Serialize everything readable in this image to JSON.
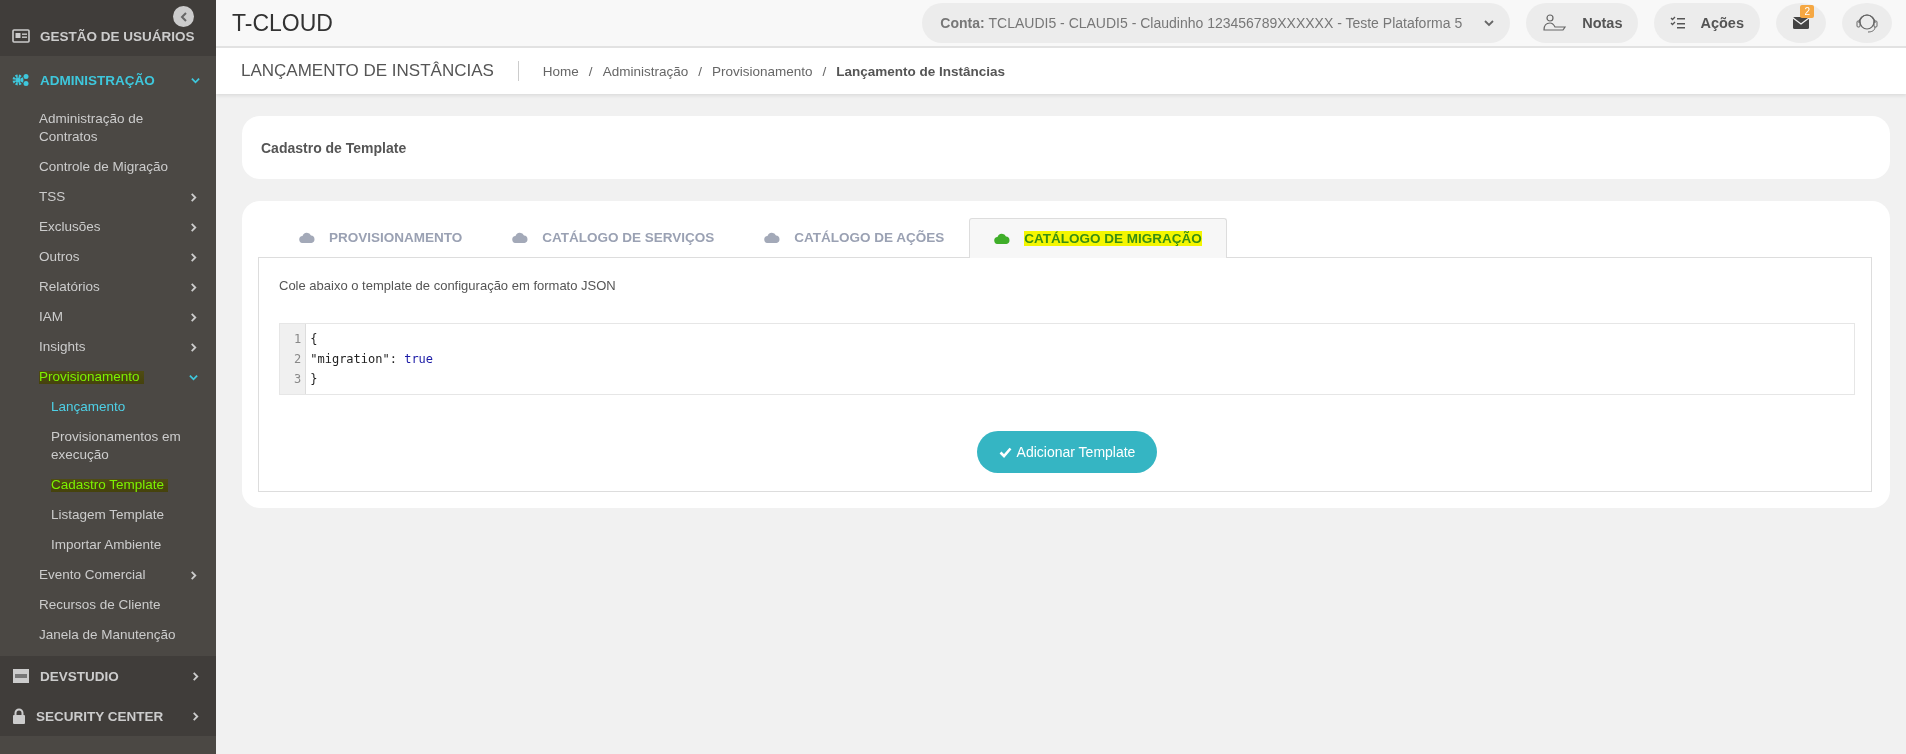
{
  "sidebar": {
    "sections": [
      {
        "label": "GESTÃO DE USUÁRIOS",
        "selected": false
      },
      {
        "label": "ADMINISTRAÇÃO",
        "selected": true,
        "expanded": true,
        "children": [
          {
            "label": "Administração de Contratos"
          },
          {
            "label": "Controle de Migração"
          },
          {
            "label": "TSS",
            "expanded": false
          },
          {
            "label": "Exclusões",
            "expanded": false
          },
          {
            "label": "Outros",
            "expanded": false
          },
          {
            "label": "Relatórios",
            "expanded": false
          },
          {
            "label": "IAM",
            "expanded": false
          },
          {
            "label": "Insights",
            "expanded": false
          },
          {
            "label": "Provisionamento",
            "expanded": true,
            "highlighted": true,
            "children": [
              {
                "label": "Lançamento",
                "selected": true,
                "highlighted": false
              },
              {
                "label": "Provisionamentos em execução",
                "selected": false,
                "highlighted": false
              },
              {
                "label": "Cadastro Template",
                "selected": false,
                "highlighted": true
              },
              {
                "label": "Listagem Template",
                "selected": false,
                "highlighted": false
              },
              {
                "label": "Importar Ambiente",
                "selected": false,
                "highlighted": false
              }
            ]
          },
          {
            "label": "Evento Comercial",
            "expanded": false
          },
          {
            "label": "Recursos de Cliente"
          },
          {
            "label": "Janela de Manutenção"
          }
        ]
      },
      {
        "label": "DEVSTUDIO",
        "selected": false,
        "expanded": false
      },
      {
        "label": "SECURITY CENTER",
        "selected": false,
        "expanded": false
      }
    ]
  },
  "header": {
    "title": "T-CLOUD",
    "account": {
      "label": "Conta:",
      "value": "TCLAUDI5 - CLAUDI5 - Claudinho 123456789XXXXXX - Teste Plataforma 5"
    },
    "buttons": [
      {
        "label": "Notas"
      },
      {
        "label": "Ações"
      }
    ],
    "mail_badge": "2"
  },
  "page": {
    "title": "LANÇAMENTO DE INSTÂNCIAS",
    "breadcrumb": [
      {
        "label": "Home",
        "current": false
      },
      {
        "label": "Administração",
        "current": false
      },
      {
        "label": "Provisionamento",
        "current": false
      },
      {
        "label": "Lançamento de Instâncias",
        "current": true
      }
    ],
    "separator": "/"
  },
  "card_title": "Cadastro de Template",
  "tabs": [
    {
      "label": "PROVISIONAMENTO",
      "selected": false,
      "highlighted": false
    },
    {
      "label": "CATÁLOGO DE SERVIÇOS",
      "selected": false,
      "highlighted": false
    },
    {
      "label": "CATÁLOGO DE AÇÕES",
      "selected": false,
      "highlighted": false
    },
    {
      "label": "CATÁLOGO DE MIGRAÇÃO",
      "selected": true,
      "highlighted": true
    }
  ],
  "instruction": "Cole abaixo o template de configuração em formato JSON",
  "code": [
    {
      "number": "1",
      "tokens": [
        {
          "text": "{",
          "kind": "punct"
        }
      ]
    },
    {
      "number": "2",
      "tokens": [
        {
          "text": "\"migration\"",
          "kind": "key"
        },
        {
          "text": ": ",
          "kind": "punct"
        },
        {
          "text": "true",
          "kind": "keyword"
        }
      ]
    },
    {
      "number": "3",
      "tokens": [
        {
          "text": "}",
          "kind": "punct"
        }
      ]
    }
  ],
  "submit": "Adicionar Template"
}
